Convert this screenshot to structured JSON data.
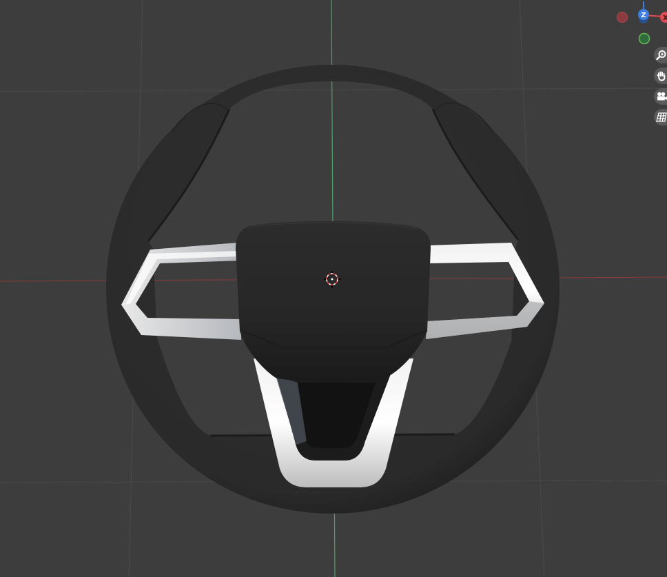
{
  "axis_gizmo": {
    "z_label": "Z",
    "x_label": "X",
    "colors": {
      "x": "#e04a52",
      "y": "#67b856",
      "z": "#3e7ee0"
    }
  },
  "nav_buttons": [
    {
      "name": "zoom-button",
      "icon": "zoom-icon"
    },
    {
      "name": "pan-button",
      "icon": "hand-icon"
    },
    {
      "name": "camera-button",
      "icon": "camera-icon"
    },
    {
      "name": "perspective-toggle-button",
      "icon": "grid-icon"
    }
  ],
  "scene": {
    "object": "steering wheel",
    "background_color": "#3d3d3d",
    "grid_color": "#4a4a4a",
    "axis_x_color": "#8a3b3b",
    "axis_y_color": "#4fa36a"
  }
}
